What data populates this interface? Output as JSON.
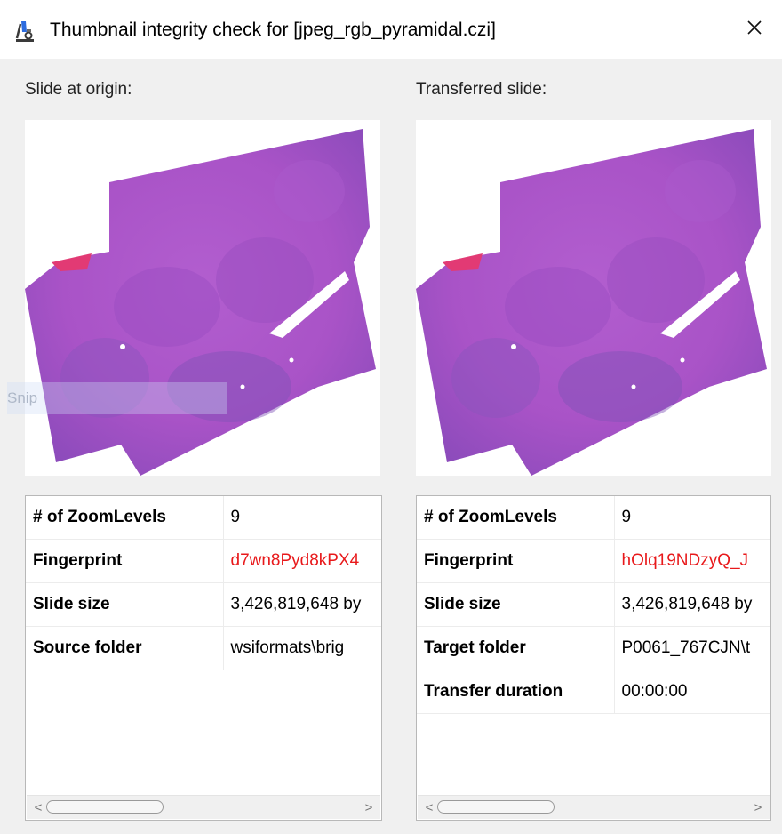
{
  "window": {
    "title": "Thumbnail integrity check for [jpeg_rgb_pyramidal.czi]",
    "app_icon": "microscope-icon",
    "close_glyph": "✕"
  },
  "overlay": {
    "ghost_text": "Snip"
  },
  "left_panel": {
    "label": "Slide at origin:",
    "thumbnail_icon": "slide-thumbnail",
    "rows": [
      {
        "key": "# of ZoomLevels",
        "value": "9"
      },
      {
        "key": "Fingerprint",
        "value": "d7wn8Pyd8kPX4",
        "value_color": "#e8191b"
      },
      {
        "key": "Slide size",
        "value": "3,426,819,648 by"
      },
      {
        "key": "Source folder",
        "value": "wsiformats\\brig"
      }
    ],
    "scroll_left": "<",
    "scroll_right": ">"
  },
  "right_panel": {
    "label": "Transferred slide:",
    "thumbnail_icon": "slide-thumbnail",
    "rows": [
      {
        "key": "# of ZoomLevels",
        "value": "9"
      },
      {
        "key": "Fingerprint",
        "value": "hOlq19NDzyQ_J",
        "value_color": "#e8191b"
      },
      {
        "key": "Slide size",
        "value": "3,426,819,648 by"
      },
      {
        "key": "Target folder",
        "value": "P0061_767CJN\\t"
      },
      {
        "key": "Transfer duration",
        "value": "00:00:00"
      }
    ],
    "scroll_left": "<",
    "scroll_right": ">"
  }
}
